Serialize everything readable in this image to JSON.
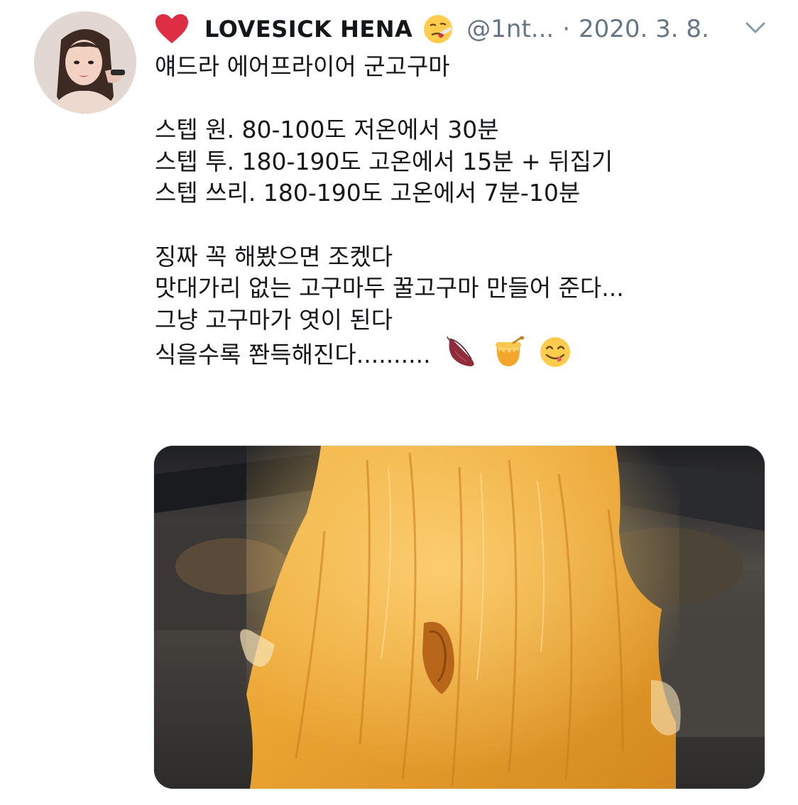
{
  "tweet": {
    "author": {
      "display_name": "LOVESICK HENA",
      "prefix_icon": "red-heart-icon",
      "suffix_icon": "face-with-thermometer-icon",
      "handle": "@1nt...",
      "separator": "·",
      "date": "2020. 3. 8.",
      "avatar": "profile-photo"
    },
    "menu_icon": "chevron-down-icon",
    "lines": [
      "얘드라 에어프라이어 군고구마",
      "",
      "스텝 원. 80-100도 저온에서 30분",
      "스텝 투. 180-190도 고온에서 15분 + 뒤집기",
      "스텝 쓰리. 180-190도 고온에서 7분-10분",
      "",
      "징짜 꼭 해봤으면 조켔다",
      "맛대가리 없는 고구마두 꿀고구마 만들어 준다...",
      "그냥 고구마가 엿이 된다",
      "식을수록 쫜득해진다.........."
    ],
    "trailing_emojis": [
      "sweet-potato-icon",
      "honey-pot-icon",
      "yum-face-icon"
    ],
    "media": {
      "type": "photo",
      "subject": "air-fried-sweet-potato"
    },
    "colors": {
      "text": "#14171a",
      "muted": "#657786",
      "heart": "#dd2e44"
    }
  }
}
